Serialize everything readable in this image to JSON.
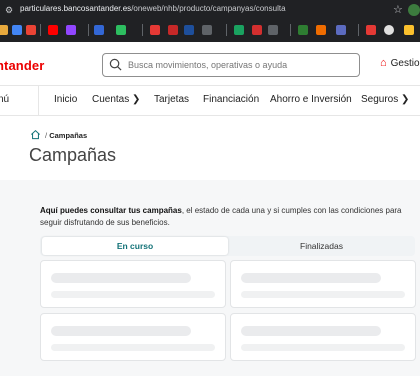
{
  "browser": {
    "url_host": "particulares.bancosantander.es",
    "url_path": "/oneweb/nhb/producto/campanyas/consulta",
    "bookmarks": [
      {
        "icon": "folder-icon",
        "color": "#e8a93d"
      },
      {
        "icon": "bookmark-icon",
        "color": "#4285f4"
      },
      {
        "icon": "bookmark-icon",
        "color": "#ea4335"
      },
      {
        "icon": "youtube-icon",
        "color": "#ff0000"
      },
      {
        "icon": "twitch-icon",
        "color": "#9146ff"
      },
      {
        "icon": "shield-icon",
        "color": "#3367d6"
      },
      {
        "icon": "evernote-icon",
        "color": "#2dbe60"
      },
      {
        "icon": "bookmark-icon",
        "color": "#e53935"
      },
      {
        "icon": "bookmark-icon",
        "color": "#c62828"
      },
      {
        "icon": "bookmark-icon",
        "color": "#1e4f9c"
      },
      {
        "icon": "e-icon",
        "color": "#5f6368"
      },
      {
        "icon": "bookmark-icon",
        "color": "#1aa260"
      },
      {
        "icon": "bookmark-icon",
        "color": "#d32f2f"
      },
      {
        "icon": "w-icon",
        "color": "#5f6368"
      },
      {
        "icon": "bookmark-icon",
        "color": "#2e7d32"
      },
      {
        "icon": "bookmark-icon",
        "color": "#ef6c00"
      },
      {
        "icon": "bookmark-icon",
        "color": "#5c6bc0"
      },
      {
        "icon": "bookmark-icon",
        "color": "#e53935"
      },
      {
        "icon": "ghost-icon",
        "color": "#e0e0e0"
      },
      {
        "icon": "bookmark-icon",
        "color": "#fbc02d"
      },
      {
        "icon": "bookmark-icon",
        "color": "#1565c0"
      },
      {
        "icon": "bookmark-icon",
        "color": "#f4511e"
      }
    ]
  },
  "header": {
    "logo": "ntander",
    "search_placeholder": "Busca movimientos, operativas o ayuda",
    "gestion_label": "Gestio"
  },
  "nav": {
    "menu_label": "nú",
    "items": [
      {
        "label": "Inicio"
      },
      {
        "label": "Cuentas ❯"
      },
      {
        "label": "Tarjetas"
      },
      {
        "label": "Financiación"
      },
      {
        "label": "Ahorro e Inversión"
      },
      {
        "label": "Seguros ❯"
      }
    ]
  },
  "breadcrumb": {
    "separator": "/",
    "current": "Campañas"
  },
  "page": {
    "title": "Campañas",
    "intro_bold": "Aquí puedes consultar tus campañas",
    "intro_rest": ", el estado de cada una y si cumples con las condiciones para seguir disfrutando de sus beneficios."
  },
  "tabs": {
    "active": "En curso",
    "inactive": "Finalizadas"
  },
  "colors": {
    "brand": "#ec0000",
    "tab_active": "#127277"
  }
}
